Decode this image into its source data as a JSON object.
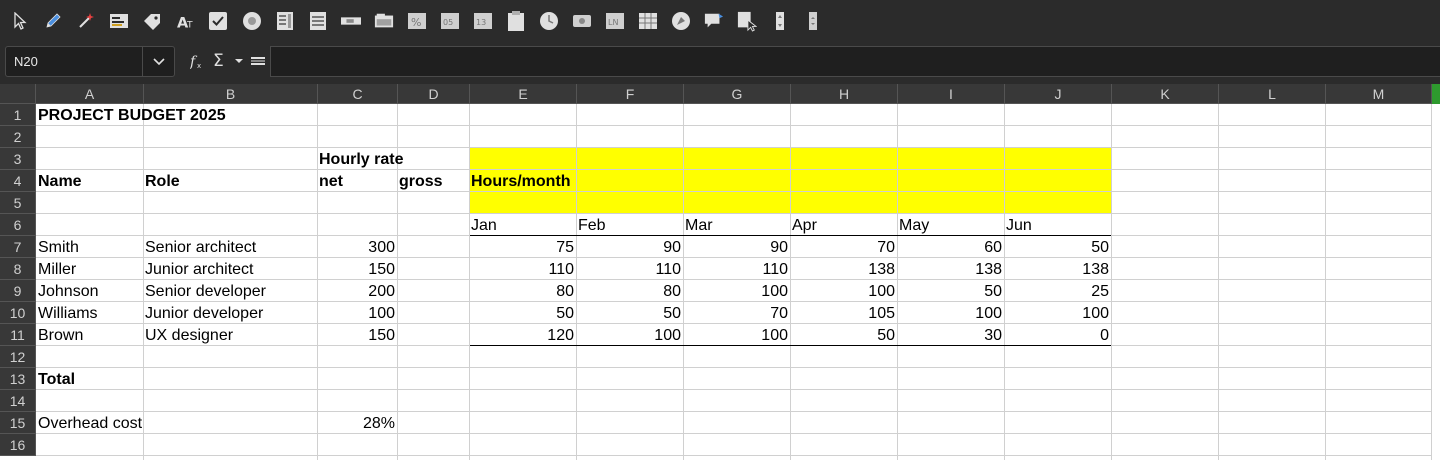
{
  "toolbar": {
    "icons": [
      "select-icon",
      "pen-icon",
      "magic-wand-icon",
      "form-design-icon",
      "tag-icon",
      "fontwork-icon",
      "checkbox-icon",
      "radio-button-icon",
      "list-box-icon",
      "combo-box-icon",
      "scrollbar-icon",
      "group-box-icon",
      "formatted-field-icon",
      "numeric-field-icon",
      "date-field-icon",
      "clipboard-icon",
      "time-field-icon",
      "image-button-icon",
      "label-field-icon",
      "table-control-icon",
      "navigation-bar-icon",
      "speech-bubble-icon",
      "file-selection-icon",
      "spin-button-icon",
      "more-controls-icon"
    ]
  },
  "formula_bar": {
    "cell_reference": "N20",
    "function_wizard": "f(x)",
    "sum_symbol": "Σ",
    "formula_value": ""
  },
  "columns": [
    "A",
    "B",
    "C",
    "D",
    "E",
    "F",
    "G",
    "H",
    "I",
    "J",
    "K",
    "L",
    "M"
  ],
  "rows": [
    "1",
    "2",
    "3",
    "4",
    "5",
    "6",
    "7",
    "8",
    "9",
    "10",
    "11",
    "12",
    "13",
    "14",
    "15",
    "16"
  ],
  "sheet": {
    "title": "PROJECT BUDGET 2025",
    "header_name": "Name",
    "header_role": "Role",
    "header_hourly_rate": "Hourly rate",
    "header_net": "net",
    "header_gross": "gross",
    "header_hours_month": "Hours/month",
    "months": [
      "Jan",
      "Feb",
      "Mar",
      "Apr",
      "May",
      "Jun"
    ],
    "people": [
      {
        "name": "Smith",
        "role": "Senior architect",
        "net": "300",
        "hours": [
          "75",
          "90",
          "90",
          "70",
          "60",
          "50"
        ]
      },
      {
        "name": "Miller",
        "role": "Junior architect",
        "net": "150",
        "hours": [
          "110",
          "110",
          "110",
          "138",
          "138",
          "138"
        ]
      },
      {
        "name": "Johnson",
        "role": "Senior developer",
        "net": "200",
        "hours": [
          "80",
          "80",
          "100",
          "100",
          "50",
          "25"
        ]
      },
      {
        "name": "Williams",
        "role": "Junior developer",
        "net": "100",
        "hours": [
          "50",
          "50",
          "70",
          "105",
          "100",
          "100"
        ]
      },
      {
        "name": "Brown",
        "role": "UX designer",
        "net": "150",
        "hours": [
          "120",
          "100",
          "100",
          "50",
          "30",
          "0"
        ]
      }
    ],
    "total_label": "Total",
    "overhead_label": "Overhead cost",
    "overhead_value": "28%"
  },
  "colors": {
    "highlight": "#ffff00",
    "toolbar_bg": "#2b2b2b",
    "header_bg": "#383838",
    "accent": "#2e9a2e"
  }
}
